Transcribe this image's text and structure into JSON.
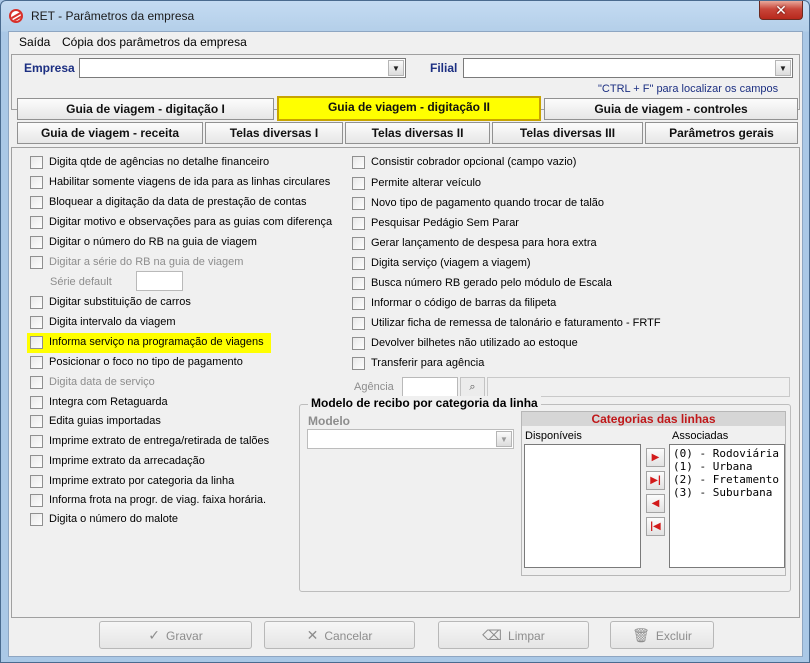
{
  "window": {
    "title": "RET - Parâmetros da empresa",
    "close_glyph": "✕"
  },
  "menu": [
    "Saída",
    "Cópia dos parâmetros da empresa"
  ],
  "company": {
    "empresa_label": "Empresa",
    "empresa_value": "",
    "filial_label": "Filial",
    "filial_value": "",
    "hint": "\"CTRL + F\" para localizar os campos"
  },
  "tabs_row1": [
    {
      "label": "Guia de viagem - digitação I",
      "active": false
    },
    {
      "label": "Guia de viagem - digitação II",
      "active": true
    },
    {
      "label": "Guia de viagem - controles",
      "active": false
    }
  ],
  "tabs_row2": [
    {
      "label": "Guia de viagem - receita"
    },
    {
      "label": "Telas diversas I"
    },
    {
      "label": "Telas diversas II"
    },
    {
      "label": "Telas diversas III"
    },
    {
      "label": "Parâmetros gerais"
    }
  ],
  "left_options": [
    {
      "label": "Digita qtde de agências no detalhe financeiro",
      "checked": false,
      "enabled": true
    },
    {
      "label": "Habilitar somente viagens de ida para as linhas circulares",
      "checked": false,
      "enabled": true
    },
    {
      "label": "Bloquear a digitação da data de prestação de contas",
      "checked": false,
      "enabled": true
    },
    {
      "label": "Digitar motivo e observações para as guias com diferença",
      "checked": false,
      "enabled": true
    },
    {
      "label": "Digitar o número do RB na guia de viagem",
      "checked": false,
      "enabled": true
    },
    {
      "label": "Digitar a série do RB na guia de viagem",
      "checked": false,
      "enabled": false
    },
    {
      "label": "Digitar substituição de carros",
      "checked": false,
      "enabled": true
    },
    {
      "label": "Digita intervalo da viagem",
      "checked": false,
      "enabled": true
    },
    {
      "label": "Informa serviço na programação de viagens",
      "checked": false,
      "enabled": true,
      "highlighted": true
    },
    {
      "label": "Posicionar o foco no tipo de pagamento",
      "checked": false,
      "enabled": true
    },
    {
      "label": "Digita data de serviço",
      "checked": false,
      "enabled": false
    },
    {
      "label": "Integra com Retaguarda",
      "checked": false,
      "enabled": true
    },
    {
      "label": "Edita guias importadas",
      "checked": false,
      "enabled": true
    },
    {
      "label": "Imprime extrato de entrega/retirada de talões",
      "checked": false,
      "enabled": true
    },
    {
      "label": "Imprime extrato da arrecadação",
      "checked": false,
      "enabled": true
    },
    {
      "label": "Imprime extrato por categoria da linha",
      "checked": false,
      "enabled": true
    },
    {
      "label": "Informa frota na progr. de viag. faixa horária.",
      "checked": false,
      "enabled": true
    },
    {
      "label": "Digita o número do malote",
      "checked": false,
      "enabled": true
    }
  ],
  "serie_default_label": "Série default",
  "right_options": [
    {
      "label": "Consistir cobrador opcional (campo vazio)",
      "checked": false
    },
    {
      "label": "Permite alterar veículo",
      "checked": false
    },
    {
      "label": "Novo tipo de pagamento quando trocar de talão",
      "checked": false
    },
    {
      "label": "Pesquisar Pedágio Sem Parar",
      "checked": false
    },
    {
      "label": "Gerar lançamento de despesa para hora extra",
      "checked": false
    },
    {
      "label": "Digita serviço (viagem a viagem)",
      "checked": false
    },
    {
      "label": "Busca número RB gerado pelo módulo de Escala",
      "checked": false
    },
    {
      "label": "Informar o código de barras da filipeta",
      "checked": false
    },
    {
      "label": "Utilizar ficha de remessa de talonário e faturamento - FRTF",
      "checked": false
    },
    {
      "label": "Devolver bilhetes não utilizado ao estoque",
      "checked": false
    },
    {
      "label": "Transferir para agência",
      "checked": false
    }
  ],
  "agencia_label": "Agência",
  "recibo": {
    "group_title": "Modelo de recibo por categoria da linha",
    "modelo_label": "Modelo",
    "categorias_title": "Categorias das linhas",
    "disponiveis_label": "Disponíveis",
    "associadas_label": "Associadas",
    "disponiveis": [],
    "associadas": [
      "(0) - Rodoviária",
      "(1) - Urbana",
      "(2) - Fretamento",
      "(3) - Suburbana"
    ]
  },
  "buttons": {
    "gravar": "Gravar",
    "cancelar": "Cancelar",
    "limpar": "Limpar",
    "excluir": "Excluir"
  },
  "colors": {
    "highlight": "#ffff00",
    "label_blue": "#1c2f82",
    "categorias_red": "#c0181a"
  }
}
